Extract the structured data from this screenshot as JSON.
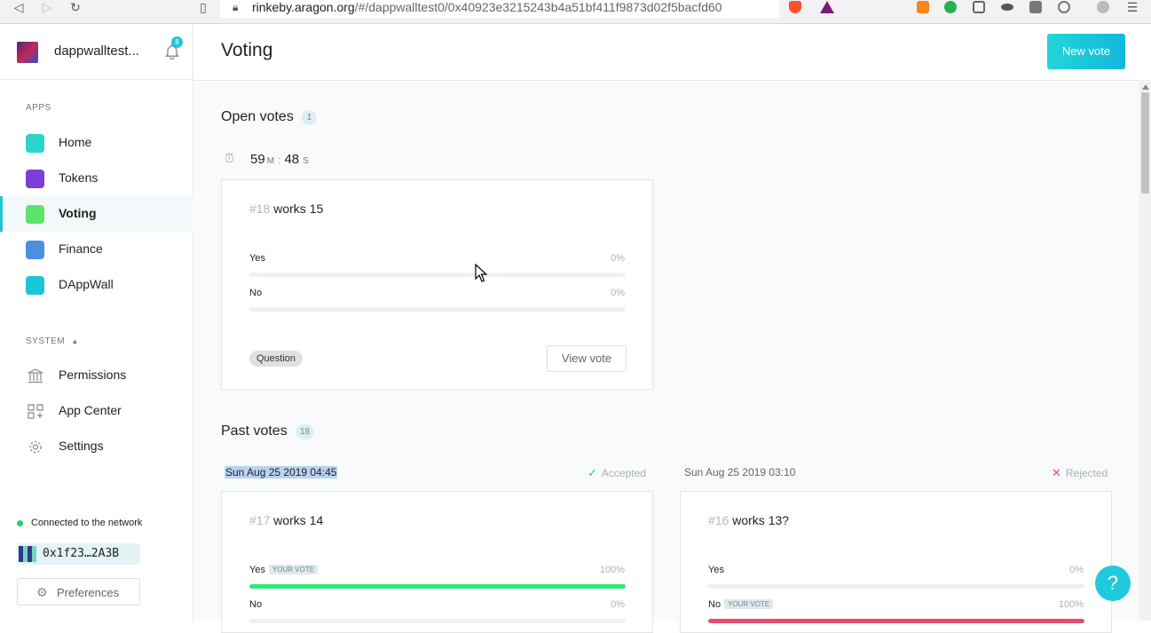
{
  "browser": {
    "url_host": "rinkeby.aragon.org",
    "url_path": "/#/dappwalltest0/0x40923e3215243b4a51bf411f9873d02f5bacfd60"
  },
  "sidebar": {
    "org_name": "dappwalltest...",
    "notification_count": "8",
    "apps_label": "APPS",
    "apps": [
      {
        "label": "Home",
        "color": "#2ad4c9"
      },
      {
        "label": "Tokens",
        "color": "#7b3fd6"
      },
      {
        "label": "Voting",
        "color": "#5ee36a"
      },
      {
        "label": "Finance",
        "color": "#4a8fe0"
      },
      {
        "label": "DAppWall",
        "color": "#19c7d9"
      }
    ],
    "system_label": "SYSTEM",
    "system": [
      {
        "label": "Permissions",
        "icon": "bank-icon"
      },
      {
        "label": "App Center",
        "icon": "grid-icon"
      },
      {
        "label": "Settings",
        "icon": "gear-icon"
      }
    ],
    "network_status": "Connected to the network",
    "account": "0x1f23…2A3B",
    "preferences_label": "Preferences"
  },
  "header": {
    "title": "Voting",
    "new_vote_label": "New vote"
  },
  "open_votes": {
    "heading": "Open votes",
    "count": "1",
    "timer_min": "59",
    "timer_min_unit": "M",
    "timer_sep": ":",
    "timer_sec": "48",
    "timer_sec_unit": "S",
    "card": {
      "number": "#18",
      "title": "works 15",
      "yes_label": "Yes",
      "yes_pct": "0%",
      "no_label": "No",
      "no_pct": "0%",
      "tag": "Question",
      "view_label": "View vote"
    }
  },
  "past_votes": {
    "heading": "Past votes",
    "count": "18",
    "your_vote_label": "YOUR VOTE",
    "items": [
      {
        "date": "Sun Aug 25 2019 04:45",
        "status": "Accepted",
        "status_color": "#2ccf6f",
        "number": "#17",
        "title": "works 14",
        "yes_label": "Yes",
        "yes_pct": "100%",
        "yes_value": 1.0,
        "yes_is_your_vote": true,
        "no_label": "No",
        "no_pct": "0%",
        "no_value": 0.0
      },
      {
        "date": "Sun Aug 25 2019 03:10",
        "status": "Rejected",
        "status_color": "#e34d6f",
        "number": "#16",
        "title": "works 13?",
        "yes_label": "Yes",
        "yes_pct": "0%",
        "yes_value": 0.0,
        "no_label": "No",
        "no_pct": "100%",
        "no_value": 1.0,
        "no_is_your_vote": true
      }
    ]
  },
  "help_label": "?"
}
